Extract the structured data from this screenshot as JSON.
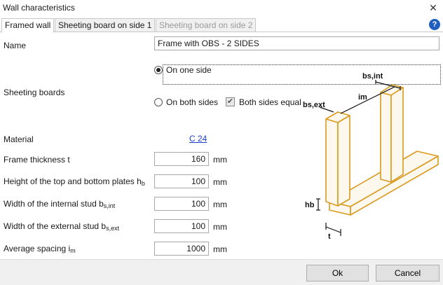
{
  "window": {
    "title": "Wall characteristics",
    "close_glyph": "✕",
    "help_glyph": "?"
  },
  "tabs": [
    {
      "label": "Framed wall",
      "state": "active"
    },
    {
      "label": "Sheeting board on side 1",
      "state": "normal"
    },
    {
      "label": "Sheeting board on side 2",
      "state": "disabled"
    }
  ],
  "form": {
    "name_label": "Name",
    "name_value": "Frame with OBS - 2 SIDES",
    "sheeting_label": "Sheeting boards",
    "option_one_side": "On one side",
    "option_both_sides": "On both sides",
    "both_sides_equal": "Both sides equal",
    "selected_option": "On one side",
    "both_sides_equal_checked": true,
    "material_label": "Material",
    "material_value": "C 24",
    "frame_thickness": {
      "label": "Frame thickness t",
      "value": "160",
      "unit": "mm"
    },
    "plates_height": {
      "label": "Height of the top and bottom plates h",
      "sub": "b",
      "value": "100",
      "unit": "mm"
    },
    "internal_stud": {
      "label": "Width of the internal stud b",
      "sub": "s,int",
      "value": "100",
      "unit": "mm"
    },
    "external_stud": {
      "label": "Width of the external stud b",
      "sub": "s,ext",
      "value": "100",
      "unit": "mm"
    },
    "spacing": {
      "label": "Average spacing i",
      "sub": "m",
      "value": "1000",
      "unit": "mm"
    }
  },
  "diagram": {
    "label_bs_int": "bs,int",
    "label_bs_ext": "bs,ext",
    "label_im": "im",
    "label_hb": "hb",
    "label_t": "t",
    "wood_color": "#d99a1e",
    "wood_fill": "#fdf8ee"
  },
  "buttons": {
    "ok": "Ok",
    "cancel": "Cancel"
  }
}
